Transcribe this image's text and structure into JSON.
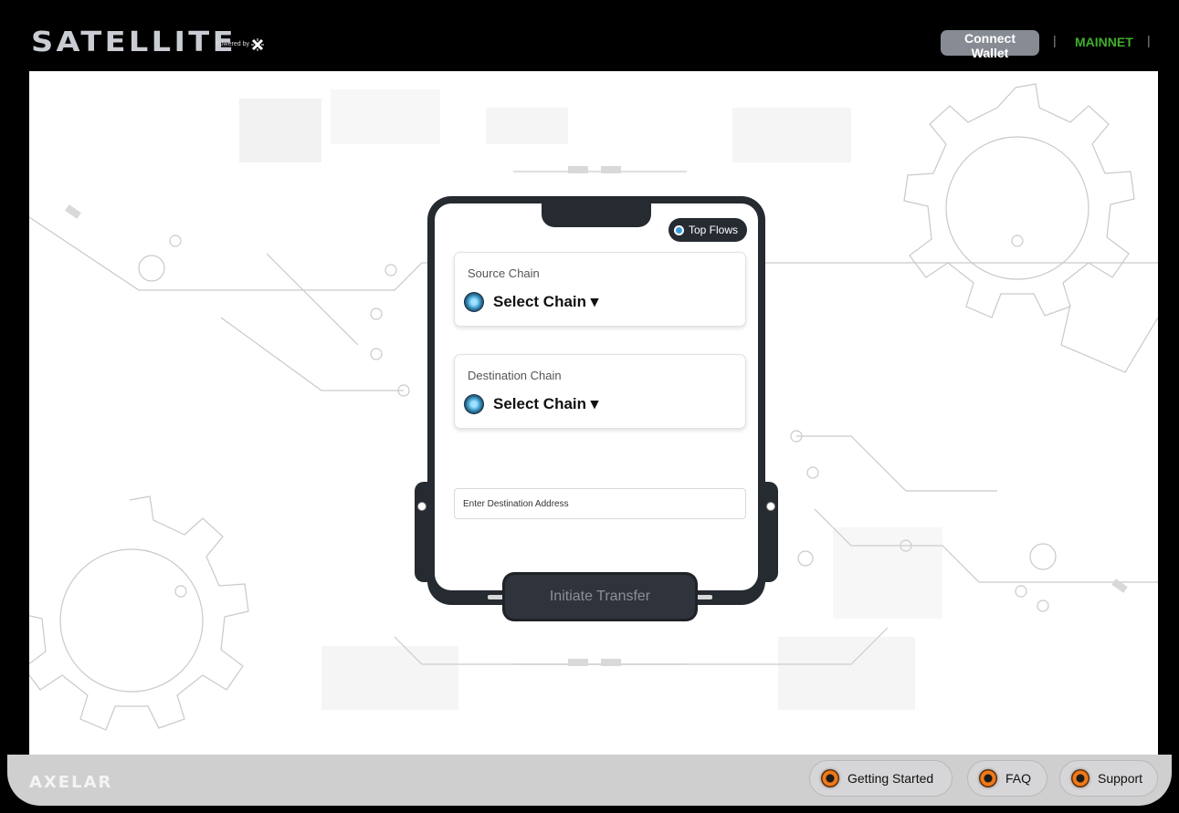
{
  "header": {
    "logo": "SATELLITE",
    "powered_by": "Powered by",
    "connect_wallet": "Connect Wallet",
    "separator": "|",
    "network": "MAINNET"
  },
  "card": {
    "top_flows": "Top Flows",
    "source": {
      "label": "Source Chain",
      "value": "Select Chain ▾"
    },
    "destination": {
      "label": "Destination Chain",
      "value": "Select Chain ▾"
    },
    "address_placeholder": "Enter Destination Address",
    "initiate": "Initiate Transfer"
  },
  "footer": {
    "brand": "AXELAR",
    "links": [
      {
        "label": "Getting Started",
        "icon": "orange-orb-icon"
      },
      {
        "label": "FAQ",
        "icon": "orange-orb-icon"
      },
      {
        "label": "Support",
        "icon": "orange-orb-icon"
      }
    ]
  },
  "colors": {
    "accent_network": "#3fae2a",
    "card_dark": "#262a31",
    "connect_button": "#868b94"
  }
}
